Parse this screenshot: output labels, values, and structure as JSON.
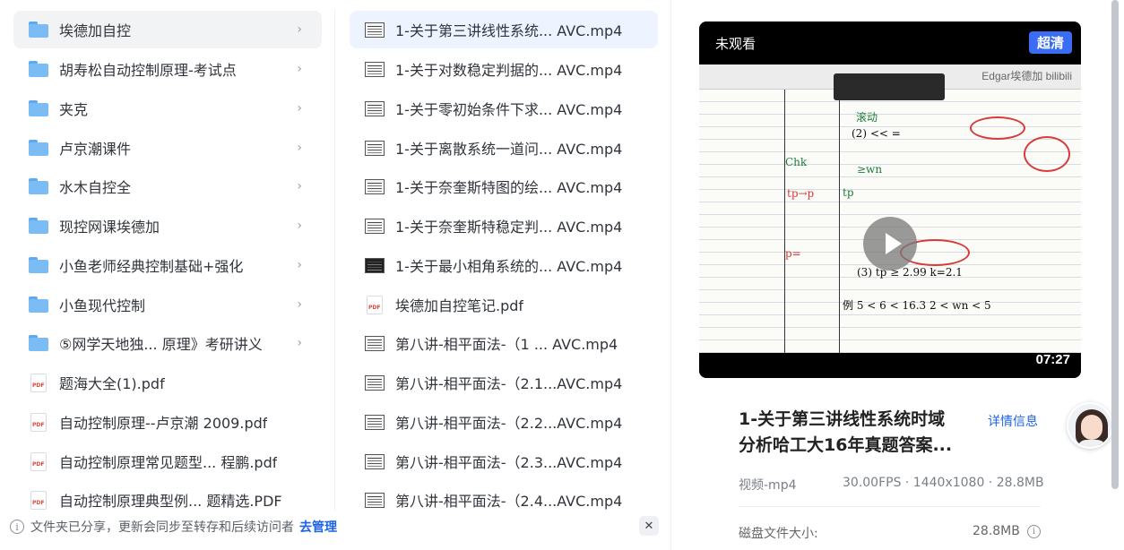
{
  "folders_column": {
    "items": [
      {
        "type": "folder",
        "name": "埃德加自控",
        "selected": true
      },
      {
        "type": "folder",
        "name": "胡寿松自动控制原理-考试点"
      },
      {
        "type": "folder",
        "name": "夹克"
      },
      {
        "type": "folder",
        "name": "卢京潮课件"
      },
      {
        "type": "folder",
        "name": "水木自控全"
      },
      {
        "type": "folder",
        "name": "现控网课埃德加"
      },
      {
        "type": "folder",
        "name": "小鱼老师经典控制基础+强化"
      },
      {
        "type": "folder",
        "name": "小鱼现代控制"
      },
      {
        "type": "folder",
        "name": "⑤网学天地独... 原理》考研讲义"
      },
      {
        "type": "pdf",
        "name": "题海大全(1).pdf"
      },
      {
        "type": "pdf",
        "name": "自动控制原理--卢京潮 2009.pdf"
      },
      {
        "type": "pdf",
        "name": "自动控制原理常见题型...   程鹏.pdf"
      },
      {
        "type": "pdf",
        "name": "自动控制原理典型例... 题精选.PDF"
      }
    ]
  },
  "files_column": {
    "items": [
      {
        "type": "video",
        "name": "1-关于第三讲线性系统... AVC.mp4",
        "selected": true
      },
      {
        "type": "video",
        "name": "1-关于对数稳定判据的... AVC.mp4"
      },
      {
        "type": "video",
        "name": "1-关于零初始条件下求... AVC.mp4"
      },
      {
        "type": "video",
        "name": "1-关于离散系统一道问... AVC.mp4"
      },
      {
        "type": "video",
        "name": "1-关于奈奎斯特图的绘... AVC.mp4"
      },
      {
        "type": "video",
        "name": "1-关于奈奎斯特稳定判... AVC.mp4"
      },
      {
        "type": "video",
        "name": "1-关于最小相角系统的... AVC.mp4"
      },
      {
        "type": "pdf",
        "name": "埃德加自控笔记.pdf"
      },
      {
        "type": "video",
        "name": "第八讲-相平面法-（1 ... AVC.mp4"
      },
      {
        "type": "video",
        "name": "第八讲-相平面法-（2.1...AVC.mp4"
      },
      {
        "type": "video",
        "name": "第八讲-相平面法-（2.2...AVC.mp4"
      },
      {
        "type": "video",
        "name": "第八讲-相平面法-（2.3...AVC.mp4"
      },
      {
        "type": "video",
        "name": "第八讲-相平面法-（2.4...AVC.mp4"
      }
    ]
  },
  "notice": {
    "message": "文件夹已分享，更新会同步至转存和后续访问者",
    "link": "去管理",
    "close_glyph": "✕",
    "info_glyph": "i"
  },
  "preview": {
    "status_badge": "未观看",
    "quality": "超清",
    "duration": "07:27",
    "watermark": "Edgar埃德加 bilibili",
    "title_line1": "1-关于第三讲线性系统时域",
    "title_line2": "分析哈工大16年真题答案...",
    "details_link": "详情信息",
    "file_type": "视频-mp4",
    "specs": "30.00FPS · 1440x1080 · 28.8MB",
    "disk_size_label": "磁盘文件大小:",
    "disk_size_value": "28.8MB",
    "info_glyph": "i"
  },
  "pdf_icon_text": "PDF",
  "chevron_glyph": "›",
  "colors": {
    "accent": "#1e63e6",
    "folder": "#7bbcf5",
    "selected_folder_bg": "#f2f3f5",
    "selected_file_bg": "#edf3ff"
  }
}
